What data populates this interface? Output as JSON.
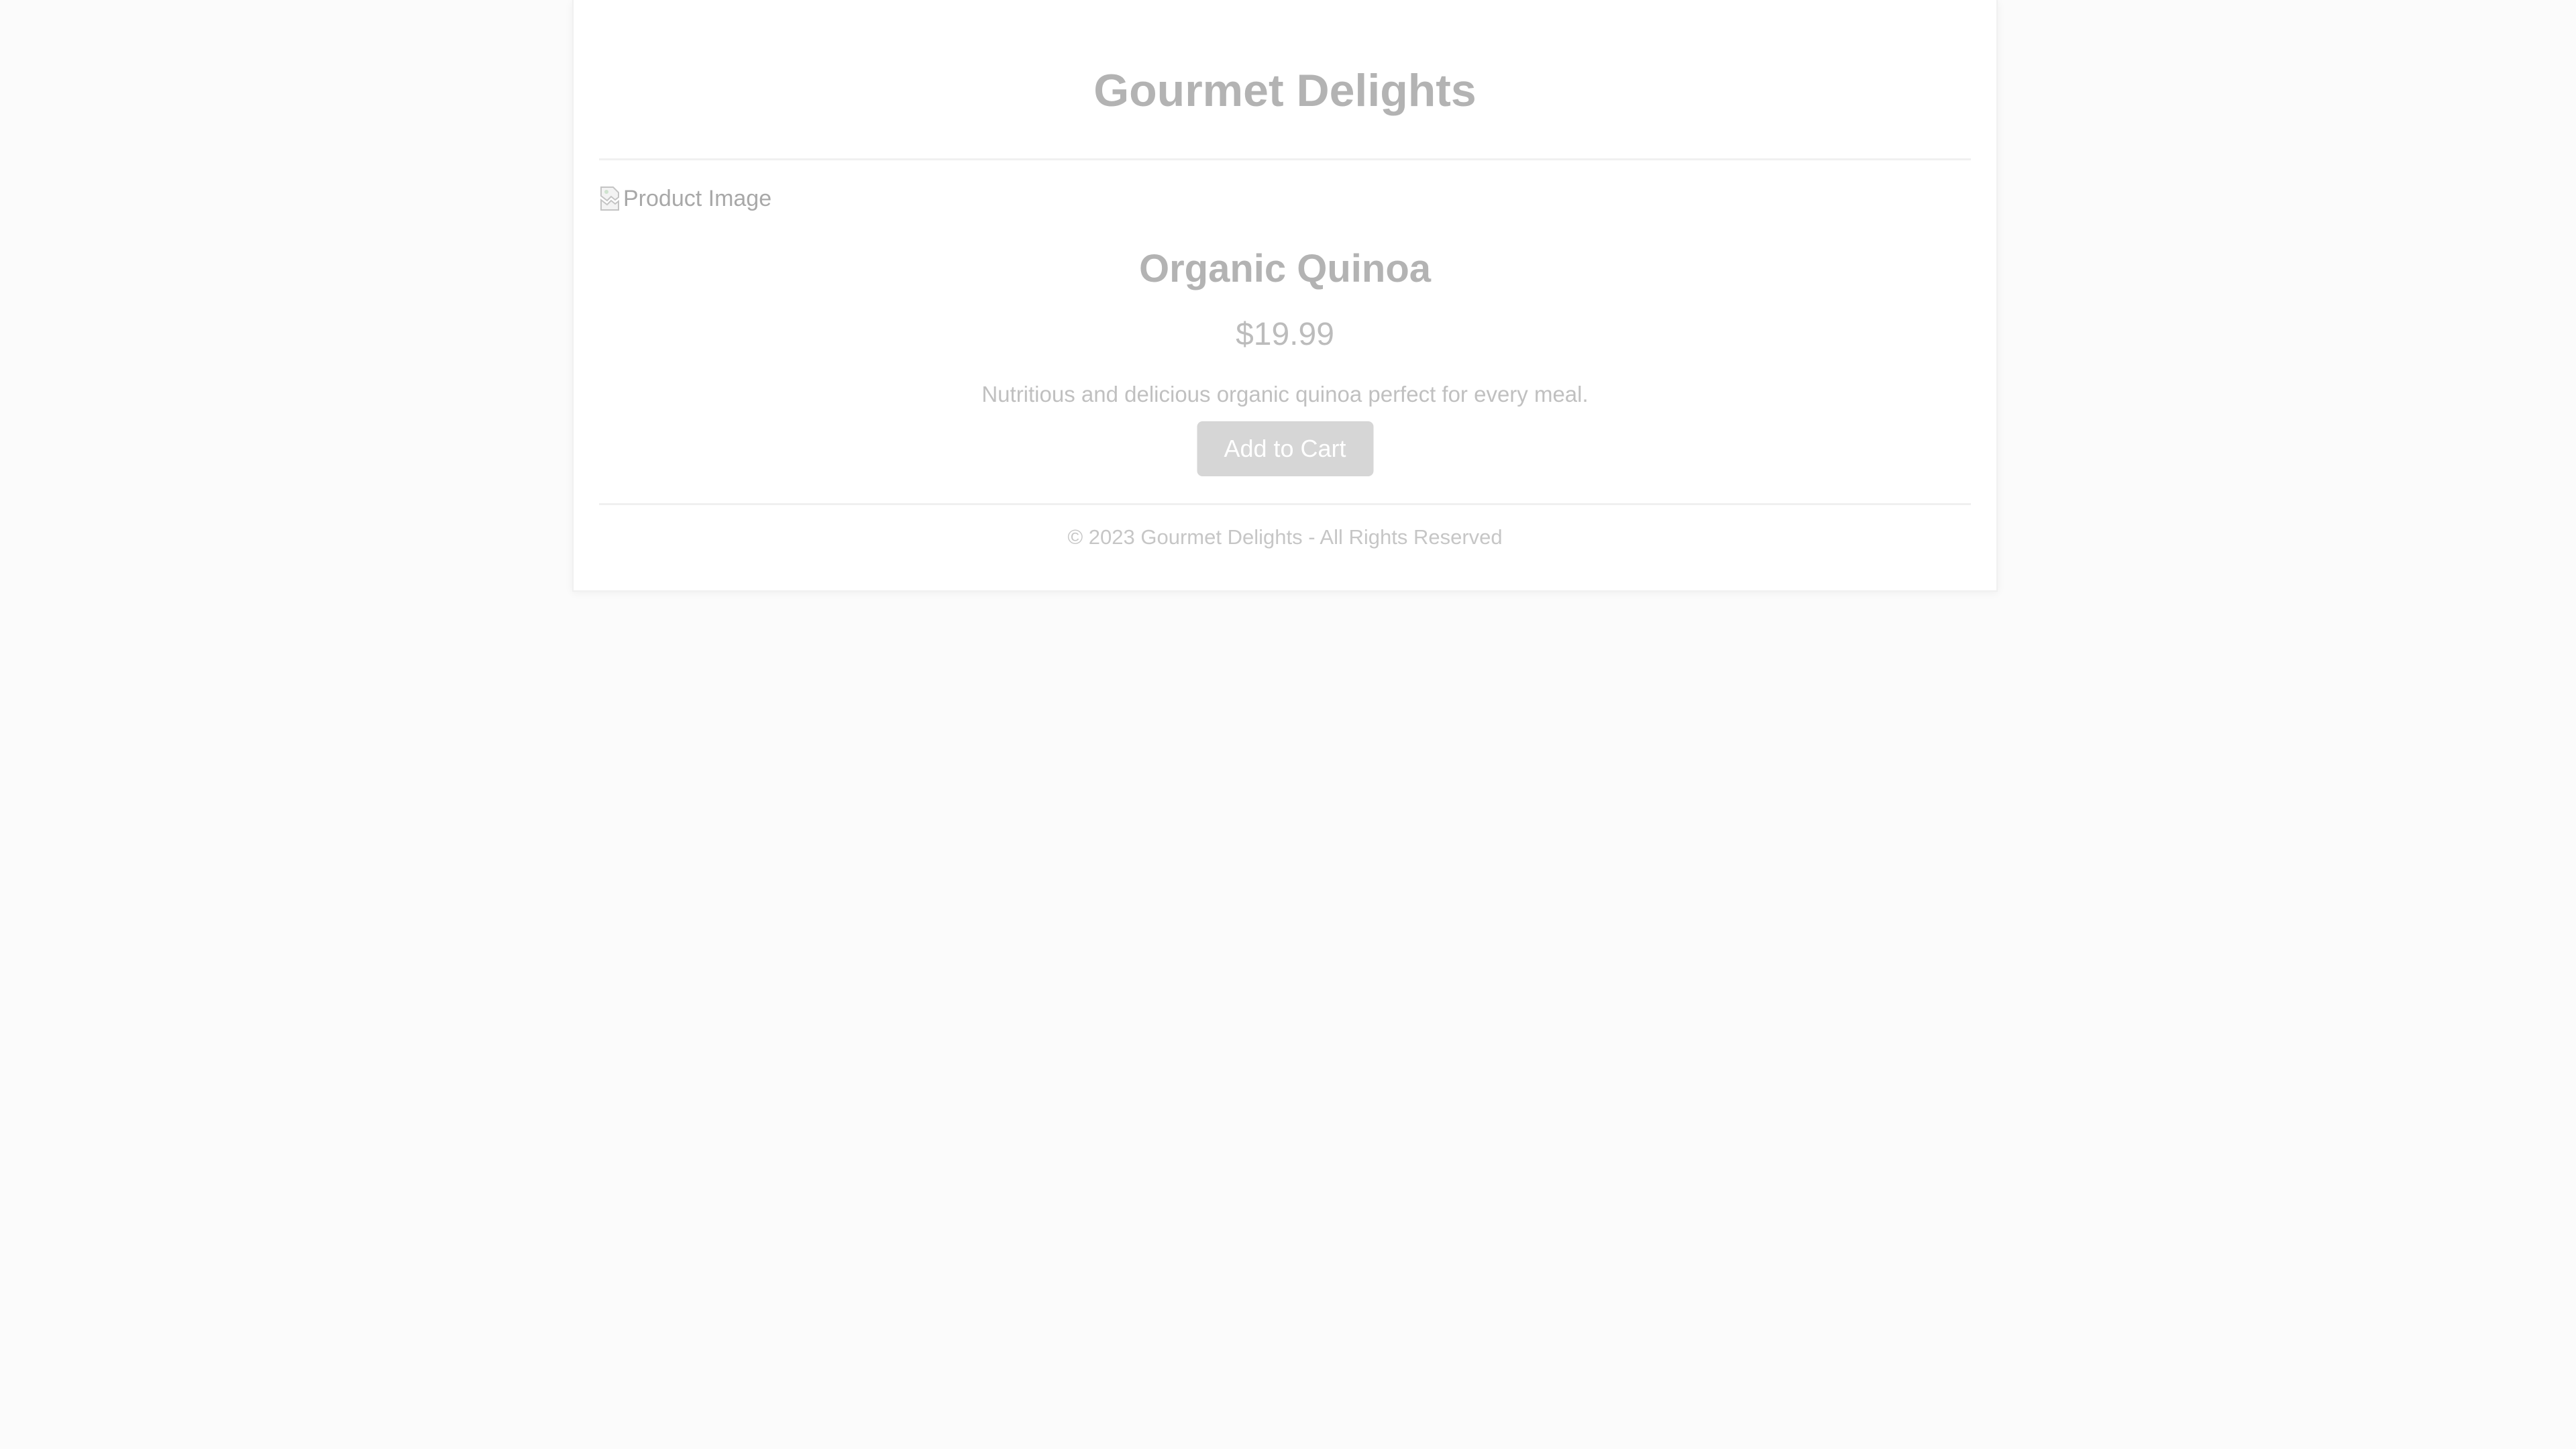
{
  "header": {
    "title": "Gourmet Delights"
  },
  "product": {
    "image_alt": "Product Image",
    "name": "Organic Quinoa",
    "price": "$19.99",
    "description": "Nutritious and delicious organic quinoa perfect for every meal.",
    "add_to_cart_label": "Add to Cart"
  },
  "footer": {
    "copyright": "© 2023 Gourmet Delights - All Rights Reserved"
  },
  "colors": {
    "page_background": "#fbfbfb",
    "card_background": "#ffffff",
    "button_background": "#d6d6d6",
    "button_text": "#ffffff",
    "title_text": "#b3b3b3"
  }
}
